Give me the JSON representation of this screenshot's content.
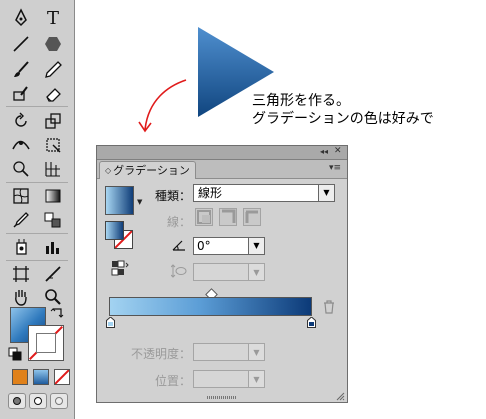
{
  "tools": [
    [
      "pen-tool-icon",
      "type-tool-icon"
    ],
    [
      "line-tool-icon",
      "polygon-tool-icon"
    ],
    [
      "paintbrush-tool-icon",
      "pencil-tool-icon"
    ],
    [
      "blob-brush-tool-icon",
      "eraser-tool-icon"
    ],
    [
      "rotate-tool-icon",
      "scale-tool-icon"
    ],
    [
      "width-tool-icon",
      "free-transform-tool-icon"
    ],
    [
      "shape-builder-tool-icon",
      "perspective-grid-tool-icon"
    ],
    [
      "mesh-tool-icon",
      "gradient-tool-icon"
    ],
    [
      "eyedropper-tool-icon",
      "blend-tool-icon"
    ],
    [
      "symbol-sprayer-tool-icon",
      "column-graph-tool-icon"
    ],
    [
      "artboard-tool-icon",
      "slice-tool-icon"
    ],
    [
      "hand-tool-icon",
      "zoom-tool-icon"
    ]
  ],
  "type_glyph": "T",
  "triangle": {
    "top_color": "#4f8fcf",
    "bottom_color": "#10457f"
  },
  "note": {
    "line1": "三角形を作る。",
    "line2": "グラデーションの色は好みで"
  },
  "gradient_panel": {
    "tab_title": "グラデーション",
    "tab_arrows": "◇",
    "collapse_glyph": "◂◂",
    "close_glyph": "✕",
    "menu_glyph": "▾≡",
    "type_label": "種類：",
    "type_value": "線形",
    "stroke_label": "線：",
    "angle_value": "0°",
    "opacity_label": "不透明度：",
    "location_label": "位置：",
    "dropdown_glyph": "▼",
    "gradient_start_color": "#a3d3f1",
    "gradient_end_color": "#0c3a78"
  },
  "fill_stroke": {
    "fill_mode_color": "#e0811a"
  }
}
